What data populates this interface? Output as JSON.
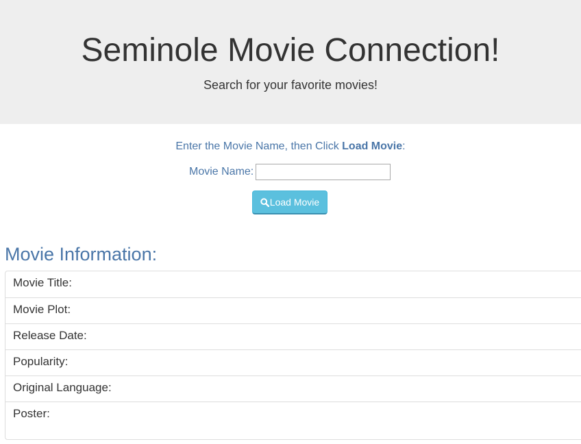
{
  "header": {
    "title": "Seminole Movie Connection!",
    "subtitle": "Search for your favorite movies!"
  },
  "search": {
    "instructions_prefix": "Enter the Movie Name, then Click ",
    "instructions_bold": "Load Movie",
    "instructions_suffix": ":",
    "name_label": "Movie Name:",
    "name_value": "",
    "button_label": "Load Movie",
    "button_icon": "search-icon"
  },
  "info": {
    "heading": "Movie Information:",
    "rows": [
      {
        "label": "Movie Title:"
      },
      {
        "label": "Movie Plot:"
      },
      {
        "label": "Release Date:"
      },
      {
        "label": "Popularity:"
      },
      {
        "label": "Original Language:"
      },
      {
        "label": "Poster:"
      }
    ]
  },
  "colors": {
    "jumbotron_bg": "#eeeeee",
    "link_blue": "#4a76a8",
    "button_info": "#5bc0de"
  }
}
